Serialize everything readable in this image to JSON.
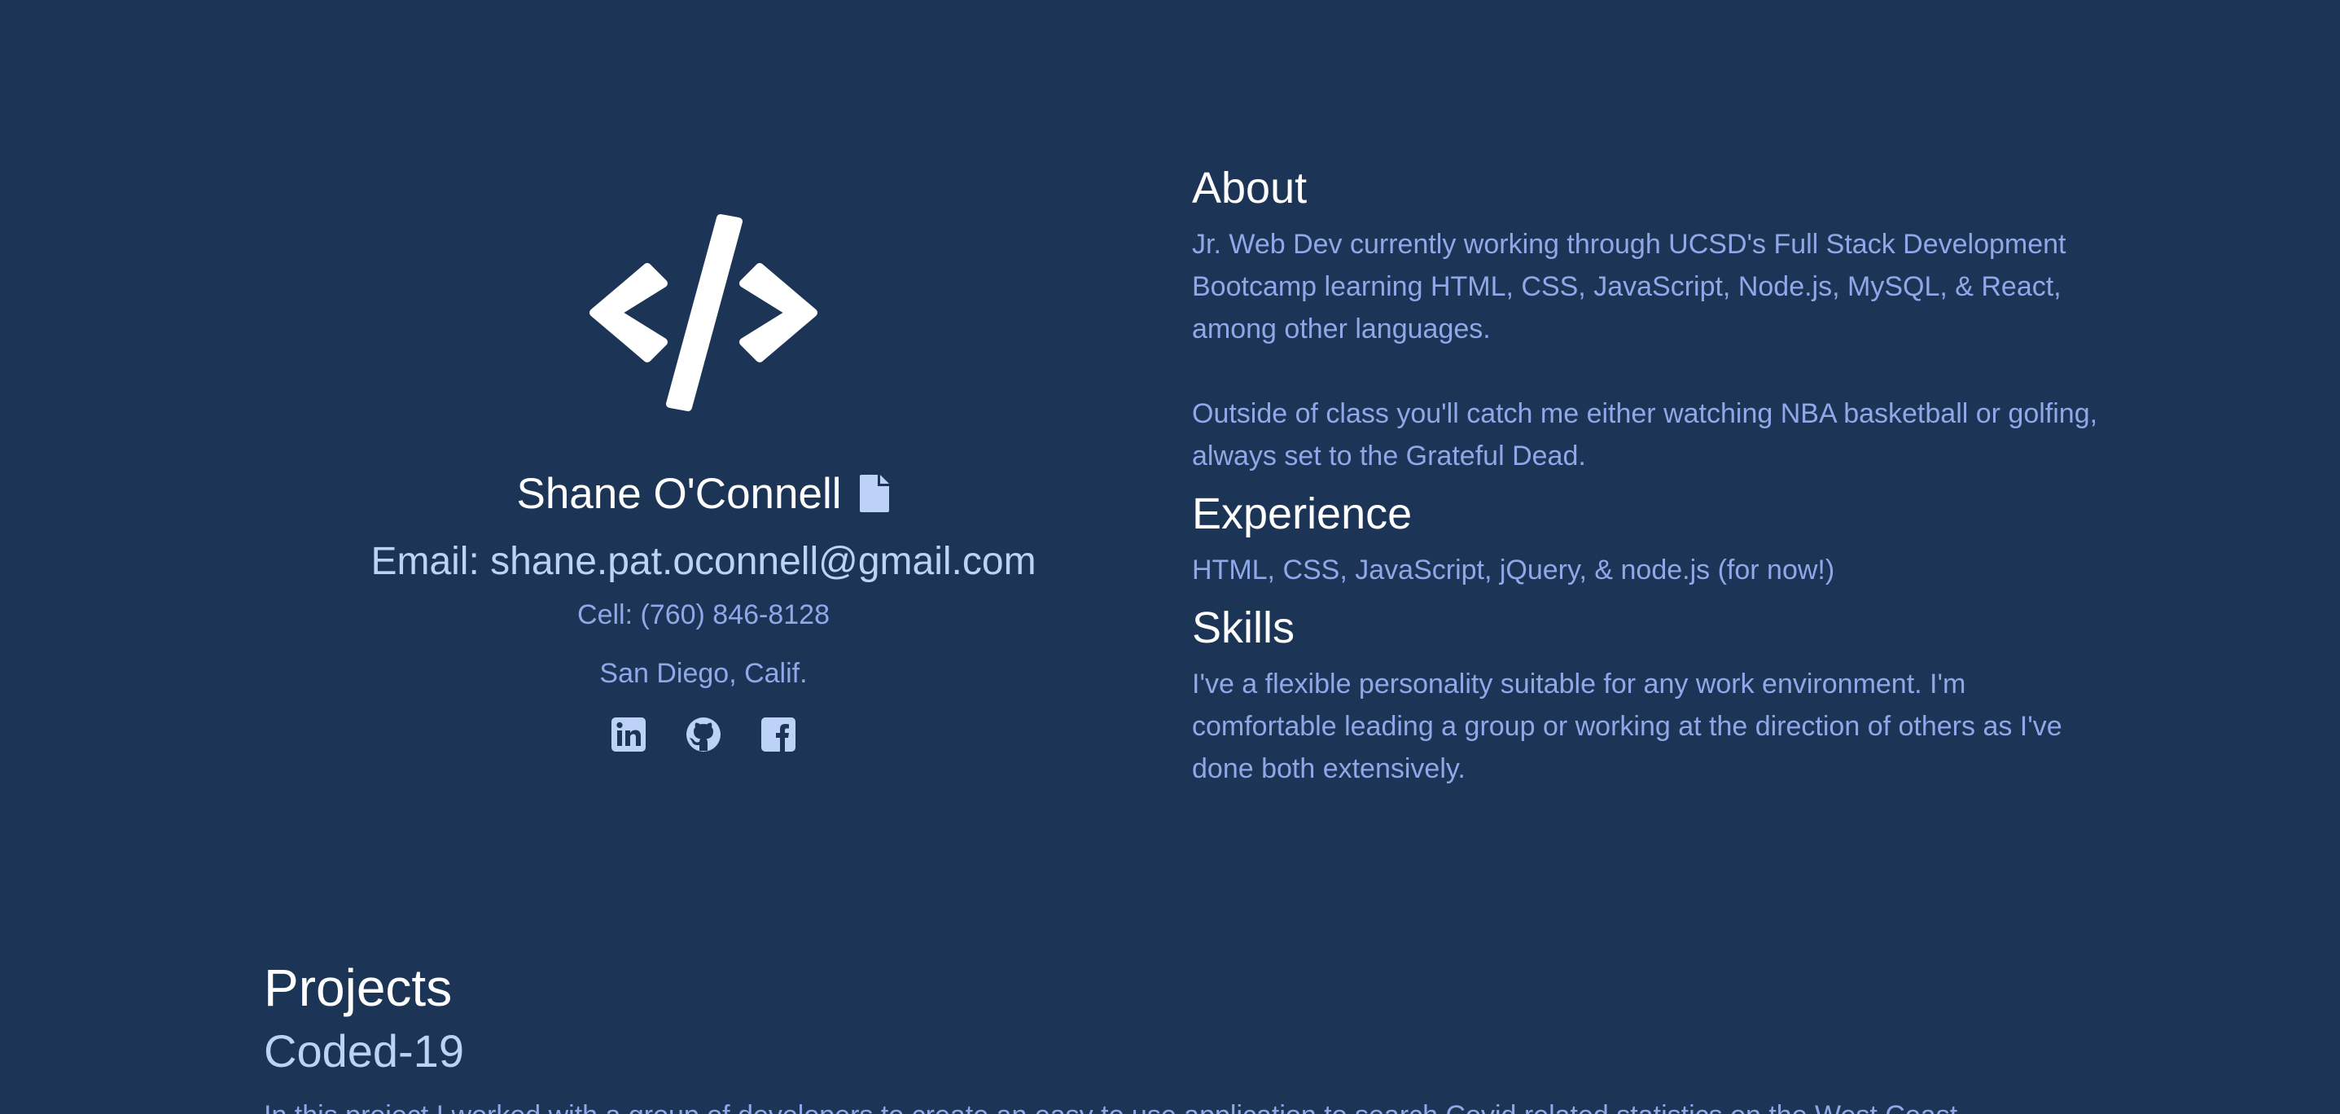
{
  "profile": {
    "name": "Shane O'Connell",
    "email": "Email: shane.pat.oconnell@gmail.com",
    "cell": "Cell: (760) 846-8128",
    "location": "San Diego, Calif.",
    "logo_icon": "code-brackets-icon",
    "resume_icon": "document-icon",
    "socials": [
      {
        "icon": "linkedin-icon"
      },
      {
        "icon": "github-icon"
      },
      {
        "icon": "facebook-icon"
      }
    ]
  },
  "about": {
    "heading": "About",
    "paragraph1": "Jr. Web Dev currently working through UCSD's Full Stack Development Bootcamp learning HTML, CSS, JavaScript, Node.js, MySQL, & React, among other languages.",
    "paragraph2": "Outside of class you'll catch me either watching NBA basketball or golfing, always set to the Grateful Dead."
  },
  "experience": {
    "heading": "Experience",
    "text": "HTML, CSS, JavaScript, jQuery, & node.js (for now!)"
  },
  "skills": {
    "heading": "Skills",
    "text": "I've a flexible personality suitable for any work environment. I'm comfortable leading a group or working at the direction of others as I've done both extensively."
  },
  "projects": {
    "heading": "Projects",
    "items": [
      {
        "name": "Coded-19",
        "description": "In this project I worked with a group of developers to create an easy to use application to search Covid related statistics on the West Coast."
      }
    ]
  },
  "colors": {
    "background": "#1c3456",
    "heading": "#ffffff",
    "body_text": "#8fa8e8",
    "accent_light": "#bcd3f7"
  }
}
